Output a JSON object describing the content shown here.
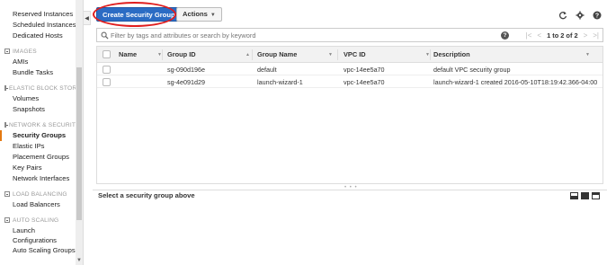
{
  "sidebar": {
    "items_top": [
      "Reserved Instances",
      "Scheduled Instances",
      "Dedicated Hosts"
    ],
    "sections": [
      {
        "title": "IMAGES",
        "items": [
          "AMIs",
          "Bundle Tasks"
        ]
      },
      {
        "title": "ELASTIC BLOCK STORE",
        "items": [
          "Volumes",
          "Snapshots"
        ]
      },
      {
        "title": "NETWORK & SECURITY",
        "items": [
          "Security Groups",
          "Elastic IPs",
          "Placement Groups",
          "Key Pairs",
          "Network Interfaces"
        ]
      },
      {
        "title": "LOAD BALANCING",
        "items": [
          "Load Balancers"
        ]
      },
      {
        "title": "AUTO SCALING",
        "items": [
          "Launch Configurations",
          "Auto Scaling Groups"
        ]
      }
    ],
    "active_item": "Security Groups"
  },
  "toolbar": {
    "create_label": "Create Security Group",
    "actions_label": "Actions"
  },
  "filter": {
    "placeholder": "Filter by tags and attributes or search by keyword"
  },
  "pager": {
    "text": "1 to 2 of 2"
  },
  "table": {
    "columns": [
      "Name",
      "Group ID",
      "Group Name",
      "VPC ID",
      "Description"
    ],
    "rows": [
      {
        "name": "",
        "group_id": "sg-090d196e",
        "group_name": "default",
        "vpc_id": "vpc-14ee5a70",
        "description": "default VPC security group"
      },
      {
        "name": "",
        "group_id": "sg-4e091d29",
        "group_name": "launch-wizard-1",
        "vpc_id": "vpc-14ee5a70",
        "description": "launch-wizard-1 created 2016-05-10T18:19:42.366-04:00"
      }
    ]
  },
  "bottom_panel": {
    "title": "Select a security group above"
  },
  "icons": {
    "refresh": "refresh-icon",
    "settings": "gear-icon",
    "help": "help-icon"
  },
  "colors": {
    "primary_button": "#2b6cc4",
    "active_indicator": "#e47911",
    "annotation": "#e01e1e"
  }
}
